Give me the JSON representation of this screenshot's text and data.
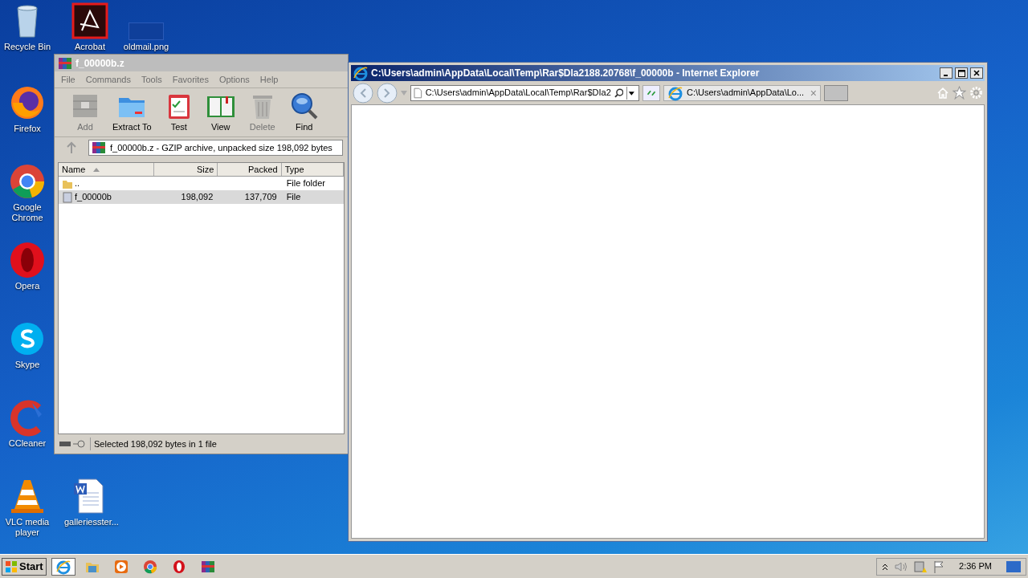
{
  "desktop_icons": [
    {
      "label": "Recycle Bin",
      "kind": "recycle"
    },
    {
      "label": "Acrobat",
      "kind": "acrobat"
    },
    {
      "label": "oldmail.png",
      "kind": "image"
    },
    {
      "label": "Firefox",
      "kind": "firefox"
    },
    {
      "label": "Google Chrome",
      "kind": "chrome"
    },
    {
      "label": "Opera",
      "kind": "opera"
    },
    {
      "label": "Skype",
      "kind": "skype"
    },
    {
      "label": "CCleaner",
      "kind": "ccleaner"
    },
    {
      "label": "VLC media player",
      "kind": "vlc"
    },
    {
      "label": "galleriesster...",
      "kind": "word"
    }
  ],
  "winrar": {
    "title": "f_00000b.z",
    "menu": [
      "File",
      "Commands",
      "Tools",
      "Favorites",
      "Options",
      "Help"
    ],
    "toolbar": [
      {
        "label": "Add",
        "kind": "add",
        "disabled": true
      },
      {
        "label": "Extract To",
        "kind": "extract",
        "disabled": false
      },
      {
        "label": "Test",
        "kind": "test",
        "disabled": false
      },
      {
        "label": "View",
        "kind": "view",
        "disabled": false
      },
      {
        "label": "Delete",
        "kind": "delete",
        "disabled": true
      },
      {
        "label": "Find",
        "kind": "find",
        "disabled": false
      }
    ],
    "address": "f_00000b.z - GZIP archive, unpacked size 198,092 bytes",
    "columns": [
      "Name",
      "Size",
      "Packed",
      "Type"
    ],
    "rows": [
      {
        "name": "..",
        "size": "",
        "packed": "",
        "type": "File folder",
        "kind": "folder",
        "selected": false
      },
      {
        "name": "f_00000b",
        "size": "198,092",
        "packed": "137,709",
        "type": "File",
        "kind": "file",
        "selected": true
      }
    ],
    "status": "Selected 198,092 bytes in 1 file"
  },
  "ie": {
    "title": "C:\\Users\\admin\\AppData\\Local\\Temp\\Rar$DIa2188.20768\\f_00000b - Internet Explorer",
    "address": "C:\\Users\\admin\\AppData\\Local\\Temp\\Rar$DIa2",
    "tab": "C:\\Users\\admin\\AppData\\Lo...",
    "tab_close": "×"
  },
  "taskbar": {
    "start": "Start",
    "items": [
      {
        "kind": "ie",
        "selected": true
      },
      {
        "kind": "explorer",
        "selected": false
      },
      {
        "kind": "media",
        "selected": false
      },
      {
        "kind": "chrome",
        "selected": false
      },
      {
        "kind": "opera",
        "selected": false
      },
      {
        "kind": "winrar",
        "selected": false
      }
    ],
    "time": "2:36 PM"
  }
}
